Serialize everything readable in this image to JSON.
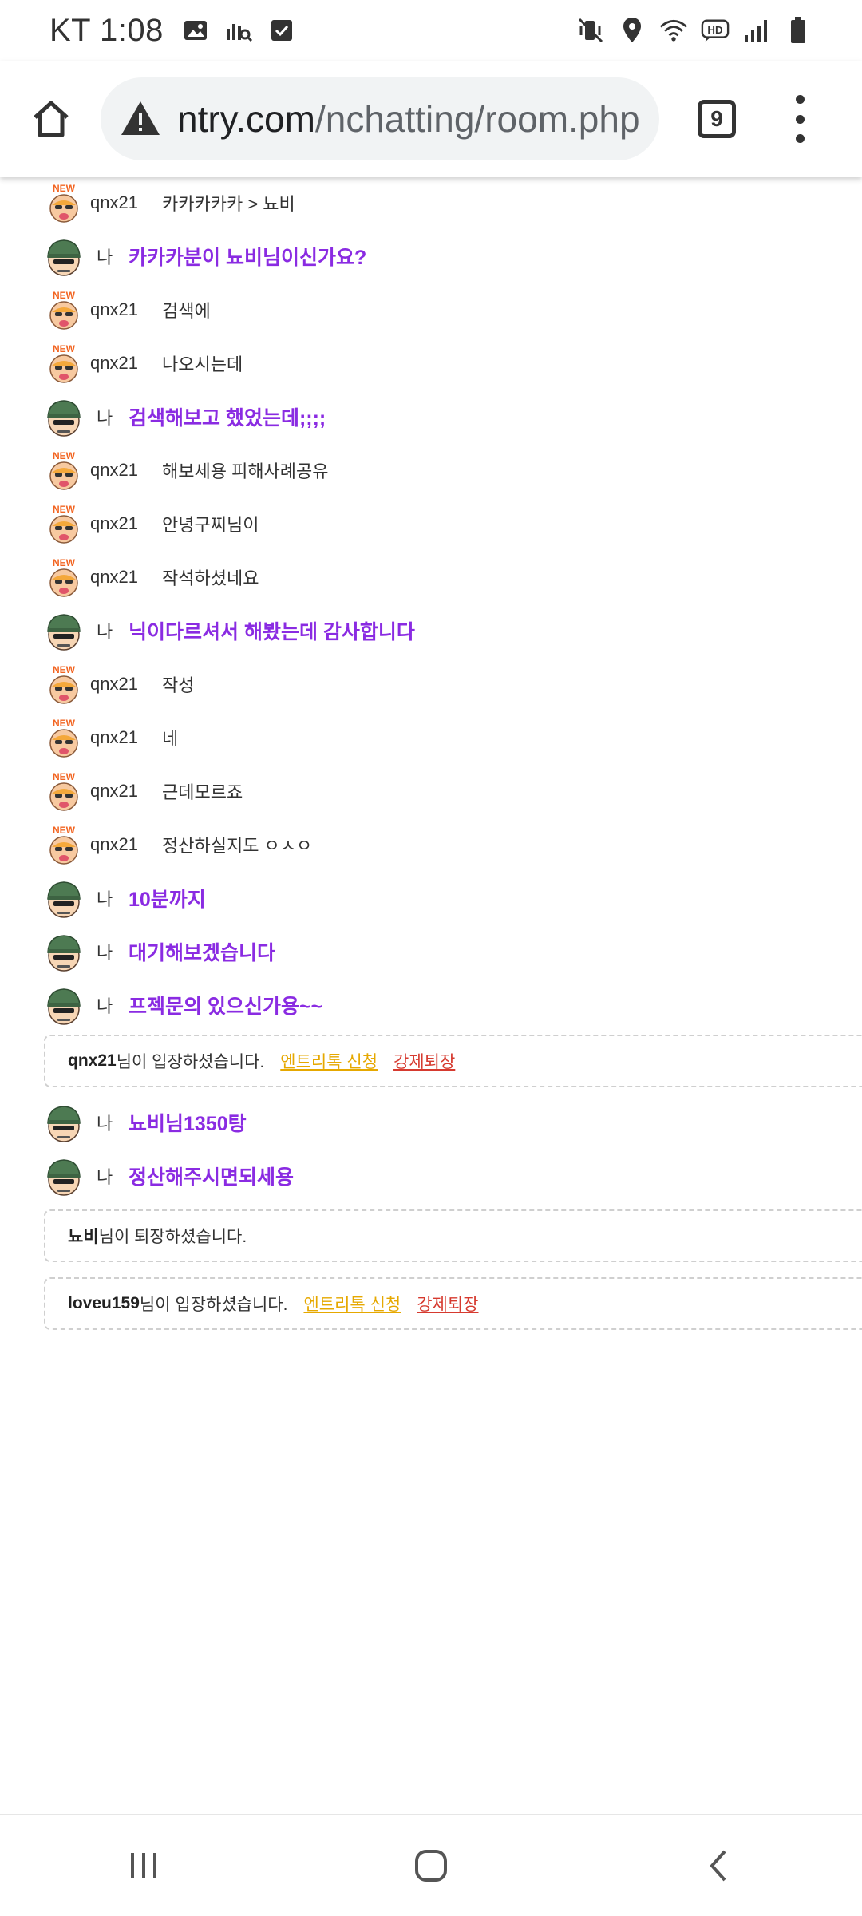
{
  "status_bar": {
    "time": "KT 1:08"
  },
  "browser": {
    "url_domain": "ntry.com",
    "url_path": "/nchatting/room.php",
    "tab_count": "9"
  },
  "chat": {
    "messages": [
      {
        "type": "other",
        "nick": "qnx21",
        "text": "카카카카카 > 뇨비"
      },
      {
        "type": "me",
        "nick": "나",
        "text": "카카카분이 뇨비님이신가요?"
      },
      {
        "type": "other",
        "nick": "qnx21",
        "text": "검색에"
      },
      {
        "type": "other",
        "nick": "qnx21",
        "text": "나오시는데"
      },
      {
        "type": "me",
        "nick": "나",
        "text": "검색해보고 했었는데;;;;"
      },
      {
        "type": "other",
        "nick": "qnx21",
        "text": "해보세용 피해사례공유"
      },
      {
        "type": "other",
        "nick": "qnx21",
        "text": "안녕구찌님이"
      },
      {
        "type": "other",
        "nick": "qnx21",
        "text": "작석하셨네요"
      },
      {
        "type": "me",
        "nick": "나",
        "text": "닉이다르셔서 해봤는데 감사합니다"
      },
      {
        "type": "other",
        "nick": "qnx21",
        "text": "작성"
      },
      {
        "type": "other",
        "nick": "qnx21",
        "text": "네"
      },
      {
        "type": "other",
        "nick": "qnx21",
        "text": "근데모르죠"
      },
      {
        "type": "other",
        "nick": "qnx21",
        "text": "정산하실지도 ㅇㅅㅇ"
      },
      {
        "type": "me",
        "nick": "나",
        "text": "10분까지"
      },
      {
        "type": "me",
        "nick": "나",
        "text": "대기해보겠습니다"
      },
      {
        "type": "me",
        "nick": "나",
        "text": "프젝문의 있으신가용~~"
      }
    ],
    "notice1": {
      "name": "qnx21",
      "text": "님이 입장하셨습니다.",
      "link1": "엔트리톡 신청",
      "link2": "강제퇴장"
    },
    "messages2": [
      {
        "type": "me",
        "nick": "나",
        "text": "뇨비님1350탕"
      },
      {
        "type": "me",
        "nick": "나",
        "text": "정산해주시면되세용"
      }
    ],
    "notice2": {
      "name": "뇨비",
      "text": "님이 퇴장하셨습니다."
    },
    "notice3": {
      "name": "loveu159",
      "text": "님이 입장하셨습니다.",
      "link1": "엔트리톡 신청",
      "link2": "강제퇴장"
    }
  },
  "icons": {
    "home": "home-icon",
    "warning": "warning-icon",
    "menu": "more-vert-icon",
    "avatar_new": "new-member-avatar-icon",
    "avatar_me": "soldier-avatar-icon"
  }
}
